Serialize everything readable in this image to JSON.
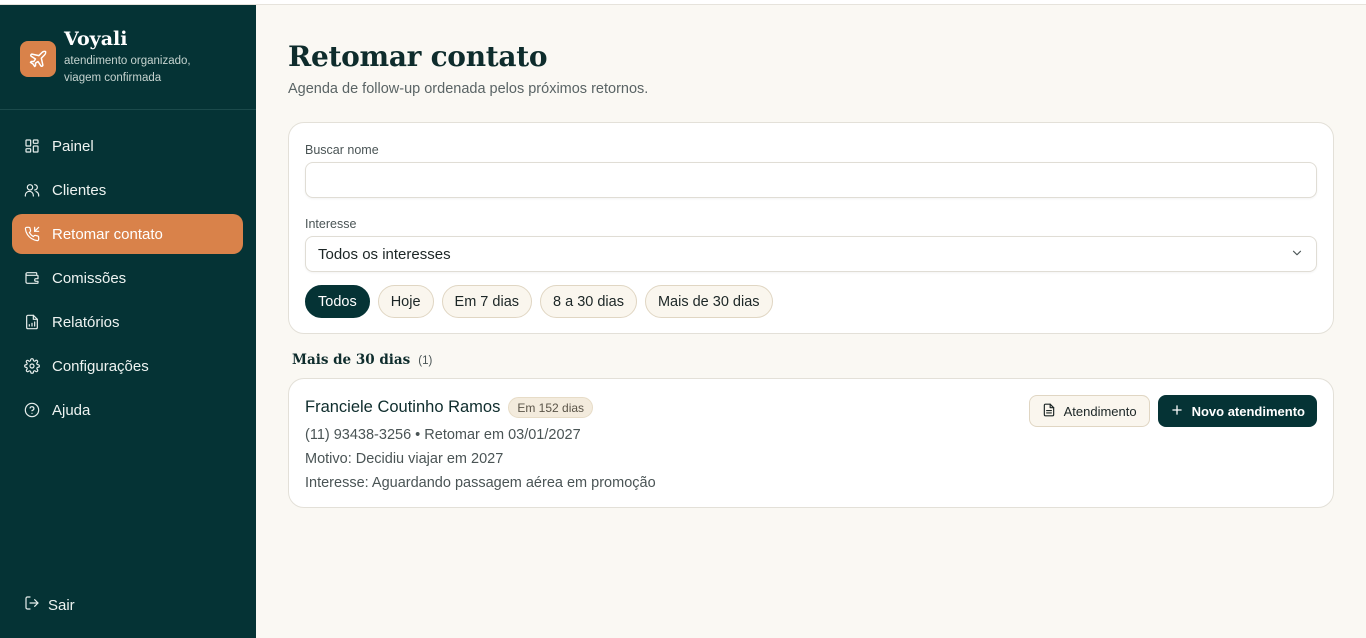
{
  "brand": {
    "name": "Voyali",
    "tagline": "atendimento organizado, viagem confirmada"
  },
  "sidebar": {
    "items": [
      {
        "label": "Painel",
        "icon": "dashboard-icon",
        "active": false
      },
      {
        "label": "Clientes",
        "icon": "users-icon",
        "active": false
      },
      {
        "label": "Retomar contato",
        "icon": "phone-callback-icon",
        "active": true
      },
      {
        "label": "Comissões",
        "icon": "wallet-icon",
        "active": false
      },
      {
        "label": "Relatórios",
        "icon": "report-icon",
        "active": false
      },
      {
        "label": "Configurações",
        "icon": "gear-icon",
        "active": false
      },
      {
        "label": "Ajuda",
        "icon": "help-icon",
        "active": false
      }
    ],
    "logout_label": "Sair"
  },
  "header": {
    "title": "Retomar contato",
    "subtitle": "Agenda de follow-up ordenada pelos próximos retornos."
  },
  "filters": {
    "search_label": "Buscar nome",
    "search_value": "",
    "interest_label": "Interesse",
    "interest_value": "Todos os interesses",
    "chips": [
      {
        "label": "Todos",
        "active": true
      },
      {
        "label": "Hoje",
        "active": false
      },
      {
        "label": "Em 7 dias",
        "active": false
      },
      {
        "label": "8 a 30 dias",
        "active": false
      },
      {
        "label": "Mais de 30 dias",
        "active": false
      }
    ]
  },
  "section": {
    "title": "Mais de 30 dias",
    "count": "(1)"
  },
  "card": {
    "name": "Franciele Coutinho Ramos",
    "badge": "Em 152 dias",
    "line1": "(11) 93438-3256 • Retomar em 03/01/2027",
    "line2": "Motivo: Decidiu viajar em 2027",
    "line3": "Interesse: Aguardando passagem aérea em promoção",
    "action_secondary": "Atendimento",
    "action_primary": "Novo atendimento"
  },
  "colors": {
    "sidebar_bg": "#053335",
    "accent": "#d9824a",
    "page_bg": "#faf8f3"
  }
}
